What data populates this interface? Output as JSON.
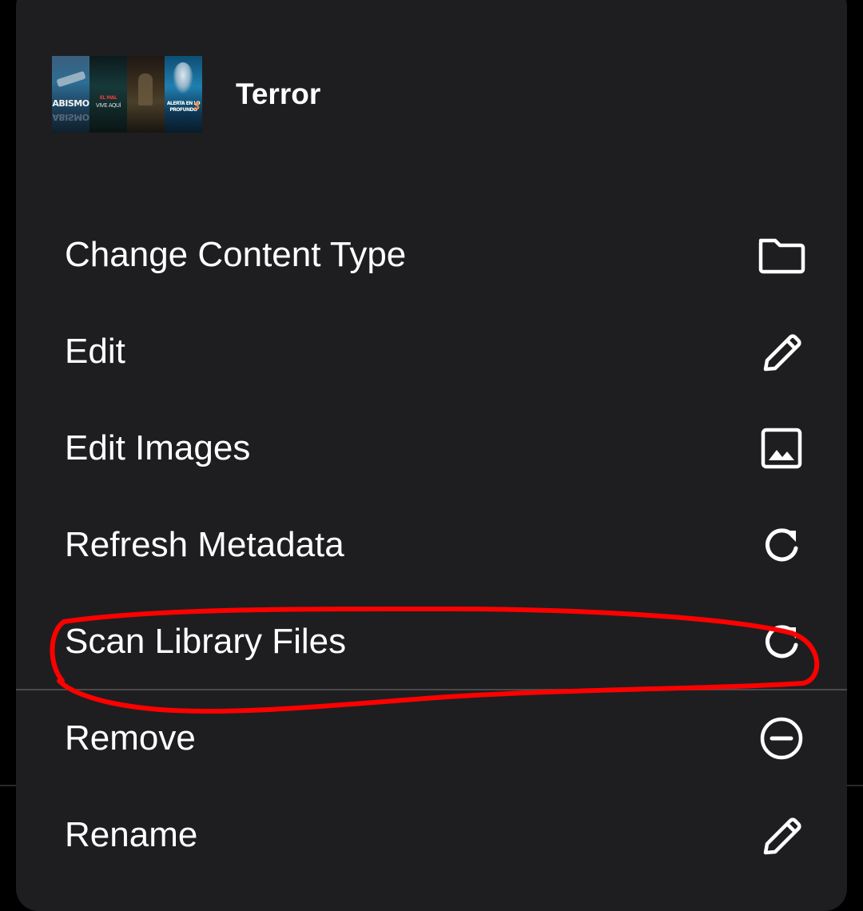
{
  "header": {
    "title": "Terror",
    "posters": [
      {
        "text": "ABISMO"
      },
      {
        "text": "EL MAL",
        "text2": "VIVE AQUÍ"
      },
      {
        "text": ""
      },
      {
        "text": "ALERTA EN LO PROFUNDO",
        "number": "3"
      }
    ]
  },
  "menu": {
    "items": [
      {
        "label": "Change Content Type",
        "icon": "folder-icon"
      },
      {
        "label": "Edit",
        "icon": "pencil-icon"
      },
      {
        "label": "Edit Images",
        "icon": "image-icon"
      },
      {
        "label": "Refresh Metadata",
        "icon": "refresh-icon"
      },
      {
        "label": "Scan Library Files",
        "icon": "refresh-icon"
      },
      {
        "label": "Remove",
        "icon": "minus-circle-icon"
      },
      {
        "label": "Rename",
        "icon": "pencil-icon"
      }
    ]
  },
  "colors": {
    "sheet_background": "#1e1e20",
    "text": "#ffffff",
    "annotation": "#ff0000"
  }
}
